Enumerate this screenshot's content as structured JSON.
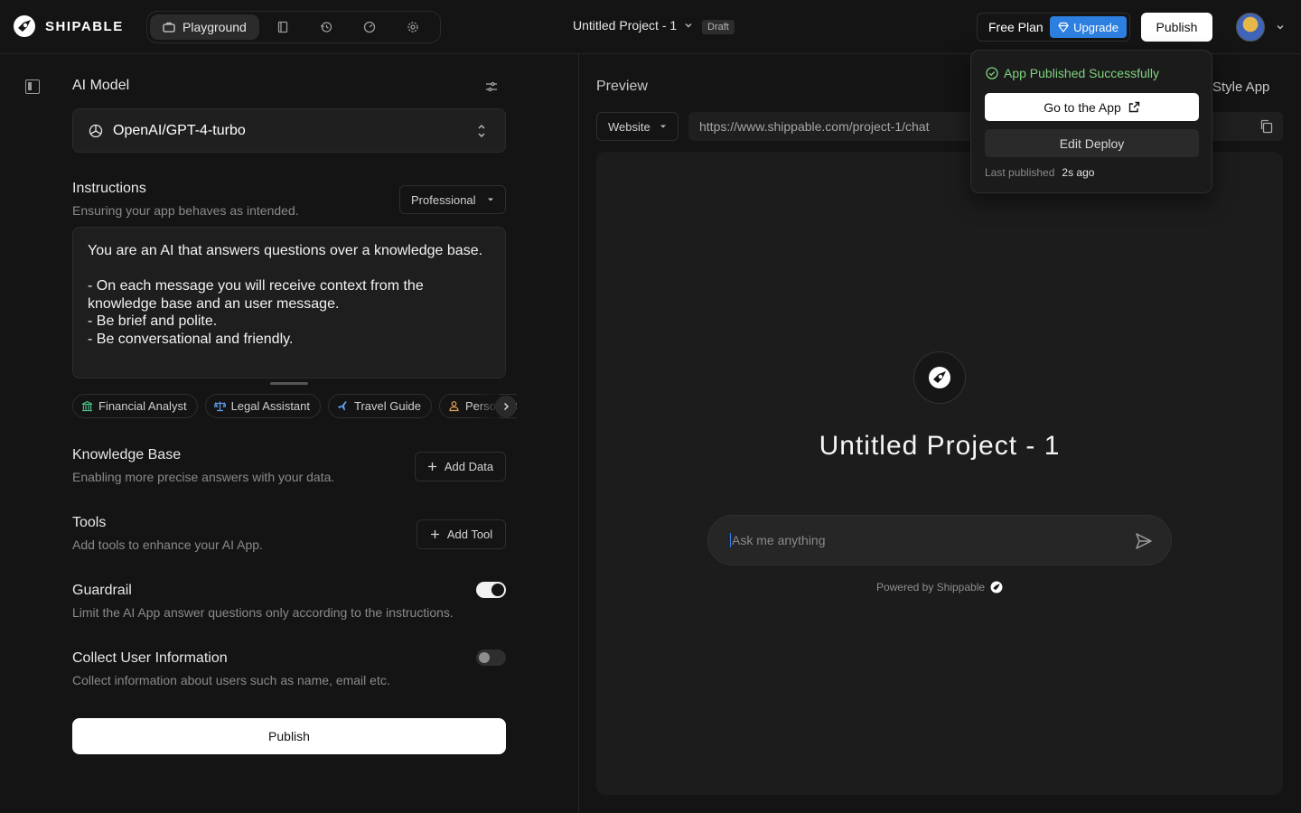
{
  "brand": {
    "name": "SHIPABLE"
  },
  "nav": {
    "playground_label": "Playground",
    "icons": [
      "book-icon",
      "history-icon",
      "gauge-icon",
      "settings-icon"
    ]
  },
  "project": {
    "title": "Untitled Project - 1",
    "status": "Draft"
  },
  "plan": {
    "label": "Free Plan",
    "upgrade_label": "Upgrade"
  },
  "header": {
    "publish_label": "Publish"
  },
  "ai_model": {
    "title": "AI Model",
    "selected": "OpenAI/GPT-4-turbo"
  },
  "instructions": {
    "title": "Instructions",
    "subtitle": "Ensuring your app behaves as intended.",
    "tone": "Professional",
    "text": "You are an AI that answers questions over a knowledge base.\n\n- On each message you will receive context from the knowledge base and an user message.\n- Be brief and polite.\n- Be conversational and friendly."
  },
  "templates": [
    {
      "label": "Financial Analyst",
      "icon": "bank-icon",
      "color": "#4cc38a"
    },
    {
      "label": "Legal Assistant",
      "icon": "scale-icon",
      "color": "#5b9cf0"
    },
    {
      "label": "Travel Guide",
      "icon": "plane-icon",
      "color": "#5b9cf0"
    },
    {
      "label": "Personal Coach",
      "icon": "person-icon",
      "color": "#e8a25c"
    }
  ],
  "knowledge_base": {
    "title": "Knowledge Base",
    "subtitle": "Enabling more precise answers with your data.",
    "button_label": "Add Data"
  },
  "tools": {
    "title": "Tools",
    "subtitle": "Add tools to enhance your AI App.",
    "button_label": "Add Tool"
  },
  "guardrail": {
    "title": "Guardrail",
    "subtitle": "Limit the AI App answer questions only according to the instructions.",
    "enabled": true
  },
  "collect_info": {
    "title": "Collect User Information",
    "subtitle": "Collect information about users such as name, email etc.",
    "enabled": false
  },
  "footer": {
    "publish_label": "Publish"
  },
  "preview": {
    "title": "Preview",
    "style_app_label": "Style App",
    "platform": "Website",
    "url": "https://www.shippable.com/project-1/chat",
    "app_title": "Untitled Project - 1",
    "input_placeholder": "Ask me anything",
    "powered_by": "Powered by Shippable"
  },
  "publish_popover": {
    "status": "App Published Successfully",
    "go_label": "Go to the App",
    "edit_label": "Edit Deploy",
    "last_label": "Last published",
    "last_value": "2s ago"
  },
  "colors": {
    "accent": "#2d7fe0",
    "success": "#7fd37f",
    "background": "#141414"
  }
}
